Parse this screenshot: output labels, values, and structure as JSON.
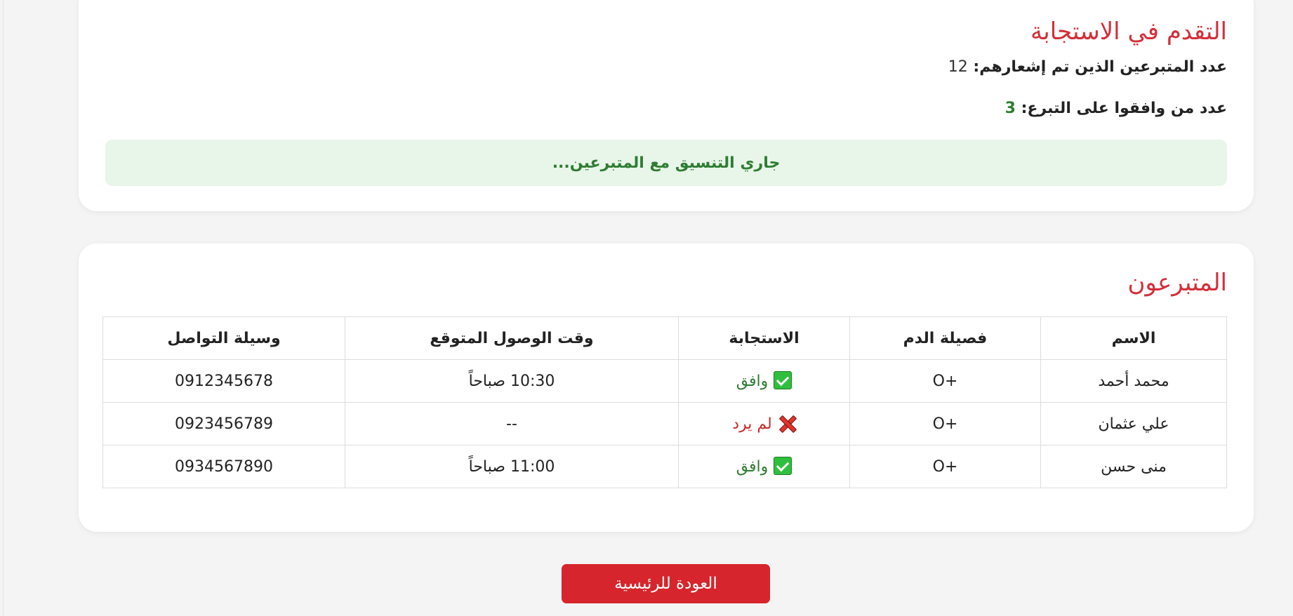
{
  "progress": {
    "title": "التقدم في الاستجابة",
    "notified_label": "عدد المتبرعين الذين تم إشعارهم: ",
    "notified_value": "12",
    "accepted_label": "عدد من وافقوا على التبرع: ",
    "accepted_value": "3",
    "status_text": "جاري التنسيق مع المتبرعين..."
  },
  "donors": {
    "title": "المتبرعون",
    "headers": {
      "name": "الاسم",
      "blood_type": "فصيلة الدم",
      "response": "الاستجابة",
      "arrival_time": "وقت الوصول المتوقع",
      "contact": "وسيلة التواصل"
    },
    "rows": [
      {
        "name": "محمد أحمد",
        "blood_type": "O+",
        "response": "وافق",
        "response_icon": "check-mark-icon",
        "arrival_time": "10:30 صباحاً",
        "contact": "0912345678"
      },
      {
        "name": "علي عثمان",
        "blood_type": "O+",
        "response": "لم يرد",
        "response_icon": "cross-mark-icon",
        "arrival_time": "--",
        "contact": "0923456789"
      },
      {
        "name": "منى حسن",
        "blood_type": "O+",
        "response": "وافق",
        "response_icon": "check-mark-icon",
        "arrival_time": "11:00 صباحاً",
        "contact": "0934567890"
      }
    ]
  },
  "actions": {
    "home_button_label": "العودة للرئيسية"
  },
  "colors": {
    "accent_red": "#d32f3a",
    "success_green": "#2e7d32",
    "status_bg": "#e8f5e9",
    "button_red": "#d6252c"
  }
}
